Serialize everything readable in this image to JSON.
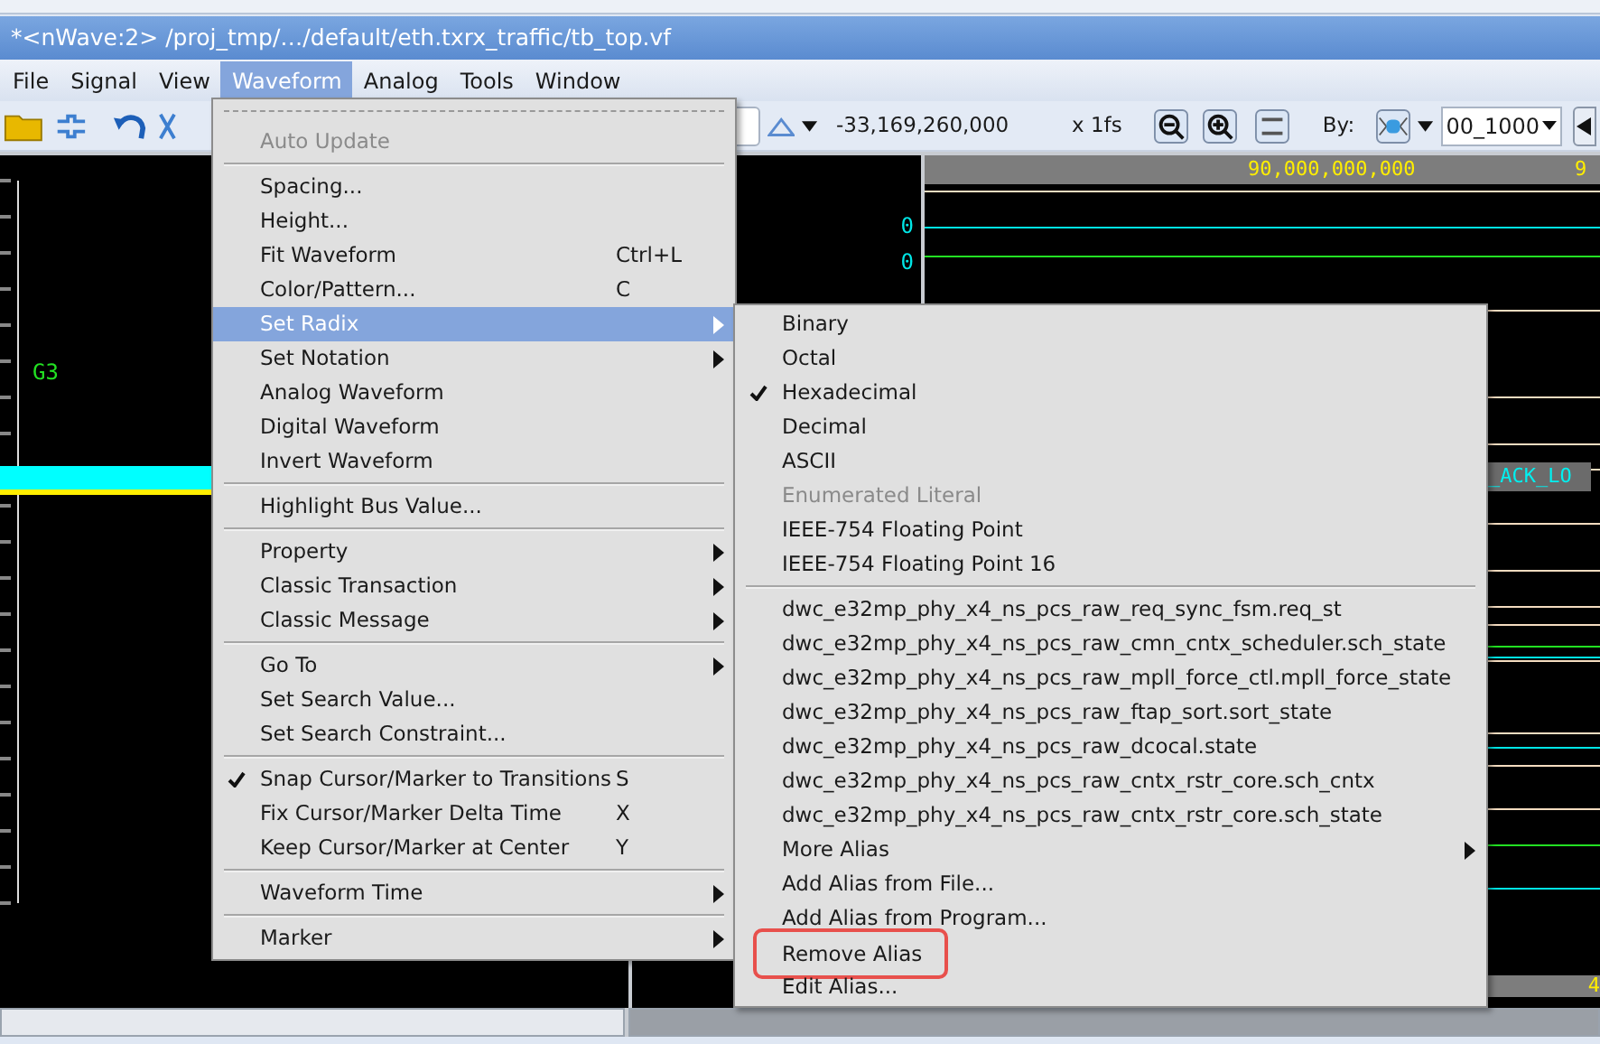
{
  "window": {
    "title": "*<nWave:2> /proj_tmp/…/default/eth.txrx_traffic/tb_top.vf"
  },
  "menubar": [
    {
      "label": "File",
      "selected": false
    },
    {
      "label": "Signal",
      "selected": false
    },
    {
      "label": "View",
      "selected": false
    },
    {
      "label": "Waveform",
      "selected": true
    },
    {
      "label": "Analog",
      "selected": false
    },
    {
      "label": "Tools",
      "selected": false
    },
    {
      "label": "Window",
      "selected": false
    }
  ],
  "toolbar": {
    "time_value": "-33,169,260,000",
    "time_unit": "x 1fs",
    "by_label": "By:",
    "by_value": "00_1000"
  },
  "signal_pane": {
    "signal_label": "G3"
  },
  "value_pane": {
    "values": [
      "0",
      "0"
    ]
  },
  "waveform_pane": {
    "ruler_label": "90,000,000,000",
    "ruler_label_edge": "9",
    "bus_value": "_ACK_LO",
    "bottom_ruler_label": "4"
  },
  "waveform_menu": {
    "items": [
      {
        "kind": "tearoff"
      },
      {
        "kind": "item",
        "label": "Auto Update",
        "disabled": true,
        "selected": false,
        "checked": false,
        "submenu": false
      },
      {
        "kind": "separator"
      },
      {
        "kind": "item",
        "label": "Spacing...",
        "disabled": false,
        "selected": false,
        "checked": false,
        "submenu": false
      },
      {
        "kind": "item",
        "label": "Height...",
        "disabled": false,
        "selected": false,
        "checked": false,
        "submenu": false
      },
      {
        "kind": "item",
        "label": "Fit Waveform",
        "shortcut": "Ctrl+L",
        "disabled": false,
        "selected": false,
        "checked": false,
        "submenu": false
      },
      {
        "kind": "item",
        "label": "Color/Pattern...",
        "shortcut": "C",
        "disabled": false,
        "selected": false,
        "checked": false,
        "submenu": false
      },
      {
        "kind": "item",
        "label": "Set Radix",
        "disabled": false,
        "selected": true,
        "checked": false,
        "submenu": true
      },
      {
        "kind": "item",
        "label": "Set Notation",
        "disabled": false,
        "selected": false,
        "checked": false,
        "submenu": true
      },
      {
        "kind": "item",
        "label": "Analog Waveform",
        "disabled": false,
        "selected": false,
        "checked": false,
        "submenu": false
      },
      {
        "kind": "item",
        "label": "Digital Waveform",
        "disabled": false,
        "selected": false,
        "checked": false,
        "submenu": false
      },
      {
        "kind": "item",
        "label": "Invert Waveform",
        "disabled": false,
        "selected": false,
        "checked": false,
        "submenu": false
      },
      {
        "kind": "separator"
      },
      {
        "kind": "item",
        "label": "Highlight Bus Value...",
        "disabled": false,
        "selected": false,
        "checked": false,
        "submenu": false
      },
      {
        "kind": "separator"
      },
      {
        "kind": "item",
        "label": "Property",
        "disabled": false,
        "selected": false,
        "checked": false,
        "submenu": true
      },
      {
        "kind": "item",
        "label": "Classic Transaction",
        "disabled": false,
        "selected": false,
        "checked": false,
        "submenu": true
      },
      {
        "kind": "item",
        "label": "Classic Message",
        "disabled": false,
        "selected": false,
        "checked": false,
        "submenu": true
      },
      {
        "kind": "separator"
      },
      {
        "kind": "item",
        "label": "Go To",
        "disabled": false,
        "selected": false,
        "checked": false,
        "submenu": true
      },
      {
        "kind": "item",
        "label": "Set Search Value...",
        "disabled": false,
        "selected": false,
        "checked": false,
        "submenu": false
      },
      {
        "kind": "item",
        "label": "Set Search Constraint...",
        "disabled": false,
        "selected": false,
        "checked": false,
        "submenu": false
      },
      {
        "kind": "separator"
      },
      {
        "kind": "item",
        "label": "Snap Cursor/Marker to Transitions",
        "shortcut": "S",
        "disabled": false,
        "selected": false,
        "checked": true,
        "submenu": false
      },
      {
        "kind": "item",
        "label": "Fix Cursor/Marker Delta Time",
        "shortcut": "X",
        "disabled": false,
        "selected": false,
        "checked": false,
        "submenu": false
      },
      {
        "kind": "item",
        "label": "Keep Cursor/Marker at Center",
        "shortcut": "Y",
        "disabled": false,
        "selected": false,
        "checked": false,
        "submenu": false
      },
      {
        "kind": "separator"
      },
      {
        "kind": "item",
        "label": "Waveform Time",
        "disabled": false,
        "selected": false,
        "checked": false,
        "submenu": true
      },
      {
        "kind": "separator"
      },
      {
        "kind": "item",
        "label": "Marker",
        "disabled": false,
        "selected": false,
        "checked": false,
        "submenu": true
      }
    ]
  },
  "radix_submenu": {
    "items": [
      {
        "kind": "item",
        "label": "Binary",
        "disabled": false,
        "checked": false,
        "submenu": false,
        "highlighted": false
      },
      {
        "kind": "item",
        "label": "Octal",
        "disabled": false,
        "checked": false,
        "submenu": false,
        "highlighted": false
      },
      {
        "kind": "item",
        "label": "Hexadecimal",
        "disabled": false,
        "checked": true,
        "submenu": false,
        "highlighted": false
      },
      {
        "kind": "item",
        "label": "Decimal",
        "disabled": false,
        "checked": false,
        "submenu": false,
        "highlighted": false
      },
      {
        "kind": "item",
        "label": "ASCII",
        "disabled": false,
        "checked": false,
        "submenu": false,
        "highlighted": false
      },
      {
        "kind": "item",
        "label": "Enumerated Literal",
        "disabled": true,
        "checked": false,
        "submenu": false,
        "highlighted": false
      },
      {
        "kind": "item",
        "label": "IEEE-754 Floating Point",
        "disabled": false,
        "checked": false,
        "submenu": false,
        "highlighted": false
      },
      {
        "kind": "item",
        "label": "IEEE-754 Floating Point 16",
        "disabled": false,
        "checked": false,
        "submenu": false,
        "highlighted": false
      },
      {
        "kind": "separator"
      },
      {
        "kind": "item",
        "label": "dwc_e32mp_phy_x4_ns_pcs_raw_req_sync_fsm.req_st",
        "disabled": false,
        "checked": false,
        "submenu": false,
        "highlighted": false
      },
      {
        "kind": "item",
        "label": "dwc_e32mp_phy_x4_ns_pcs_raw_cmn_cntx_scheduler.sch_state",
        "disabled": false,
        "checked": false,
        "submenu": false,
        "highlighted": false
      },
      {
        "kind": "item",
        "label": "dwc_e32mp_phy_x4_ns_pcs_raw_mpll_force_ctl.mpll_force_state",
        "disabled": false,
        "checked": false,
        "submenu": false,
        "highlighted": false
      },
      {
        "kind": "item",
        "label": "dwc_e32mp_phy_x4_ns_pcs_raw_ftap_sort.sort_state",
        "disabled": false,
        "checked": false,
        "submenu": false,
        "highlighted": false
      },
      {
        "kind": "item",
        "label": "dwc_e32mp_phy_x4_ns_pcs_raw_dcocal.state",
        "disabled": false,
        "checked": false,
        "submenu": false,
        "highlighted": false
      },
      {
        "kind": "item",
        "label": "dwc_e32mp_phy_x4_ns_pcs_raw_cntx_rstr_core.sch_cntx",
        "disabled": false,
        "checked": false,
        "submenu": false,
        "highlighted": false
      },
      {
        "kind": "item",
        "label": "dwc_e32mp_phy_x4_ns_pcs_raw_cntx_rstr_core.sch_state",
        "disabled": false,
        "checked": false,
        "submenu": false,
        "highlighted": false
      },
      {
        "kind": "item",
        "label": "More Alias",
        "disabled": false,
        "checked": false,
        "submenu": true,
        "highlighted": false
      },
      {
        "kind": "item",
        "label": "Add Alias from File...",
        "disabled": false,
        "checked": false,
        "submenu": false,
        "highlighted": false
      },
      {
        "kind": "item",
        "label": "Add Alias from Program...",
        "disabled": false,
        "checked": false,
        "submenu": false,
        "highlighted": false
      },
      {
        "kind": "item",
        "label": "Remove Alias",
        "disabled": false,
        "checked": false,
        "submenu": false,
        "highlighted": true
      },
      {
        "kind": "item",
        "label": "Edit Alias...",
        "disabled": false,
        "checked": false,
        "submenu": false,
        "highlighted": false
      }
    ]
  }
}
